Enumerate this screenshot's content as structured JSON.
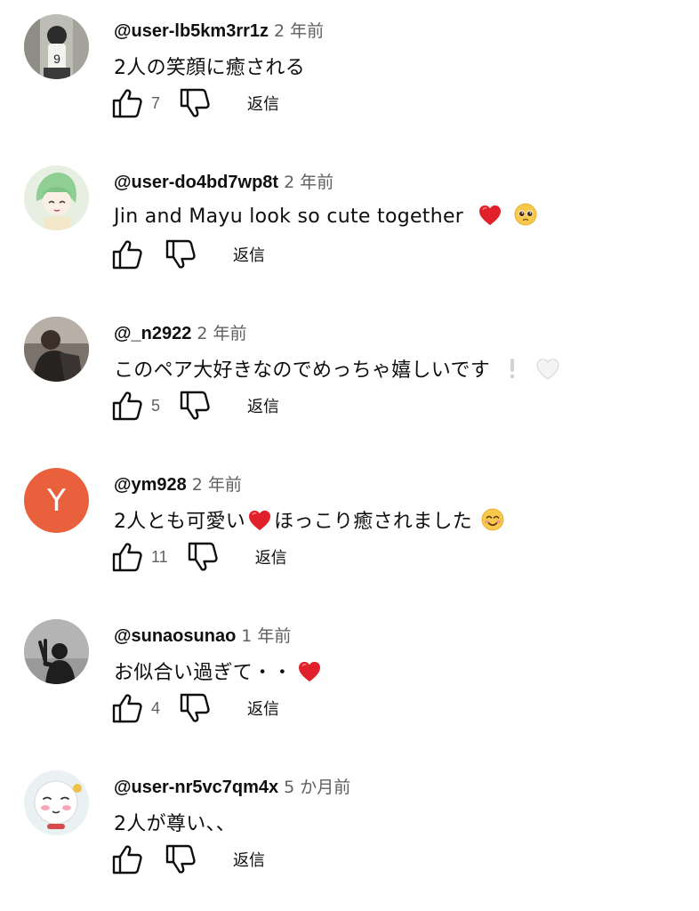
{
  "comments": [
    {
      "user": "@user-lb5km3rr1z",
      "time": "2 年前",
      "text": "2人の笑顔に癒される",
      "likes": "7",
      "reply": "返信",
      "avatar": "avatar-basketball-icon"
    },
    {
      "user": "@user-do4bd7wp8t",
      "time": "2 年前",
      "text": "Jin and Mayu look so cute together",
      "likes": "",
      "reply": "返信",
      "avatar": "avatar-anime-girl-icon"
    },
    {
      "user": "@_n2922",
      "time": "2 年前",
      "text": "このペア大好きなのでめっちゃ嬉しいです",
      "likes": "5",
      "reply": "返信",
      "avatar": "avatar-person-photo-icon"
    },
    {
      "user": "@ym928",
      "time": "2 年前",
      "text": "2人とも可愛い",
      "text2": "ほっこり癒されました",
      "likes": "11",
      "reply": "返信",
      "avatar_letter": "Y",
      "avatar_color": "#e8613c"
    },
    {
      "user": "@sunaosunao",
      "time": "1 年前",
      "text": "お似合い過ぎて・・",
      "likes": "4",
      "reply": "返信",
      "avatar": "avatar-shadow-peace-icon"
    },
    {
      "user": "@user-nr5vc7qm4x",
      "time": "5 か月前",
      "text": "2人が尊い、、",
      "likes": "",
      "reply": "返信",
      "avatar": "avatar-cute-character-icon"
    }
  ],
  "colors": {
    "heart": "#e0202a",
    "secondary_text": "#606060",
    "white_heart": "#f0f0f0"
  }
}
